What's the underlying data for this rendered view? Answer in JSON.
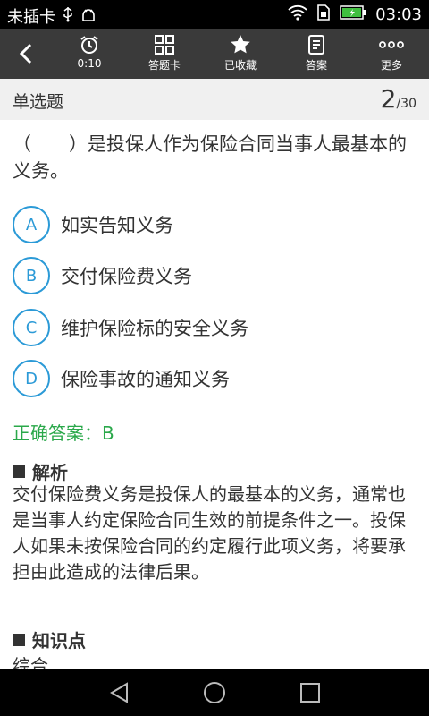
{
  "statusbar": {
    "carrier": "未插卡",
    "time": "03:03",
    "icons": [
      "usb-icon",
      "android-debug-icon",
      "wifi-icon",
      "sim-icon",
      "battery-icon"
    ]
  },
  "toolbar": {
    "items": [
      {
        "icon": "alarm-clock-icon",
        "label": "0:10"
      },
      {
        "icon": "grid-icon",
        "label": "答题卡"
      },
      {
        "icon": "star-icon",
        "label": "已收藏"
      },
      {
        "icon": "document-icon",
        "label": "答案"
      },
      {
        "icon": "more-dots-icon",
        "label": "更多"
      }
    ]
  },
  "question": {
    "type": "单选题",
    "current": "2",
    "total": "/30",
    "text": "（　　）是投保人作为保险合同当事人最基本的义务。",
    "options": [
      {
        "letter": "A",
        "text": "如实告知义务"
      },
      {
        "letter": "B",
        "text": "交付保险费义务"
      },
      {
        "letter": "C",
        "text": "维护保险标的安全义务"
      },
      {
        "letter": "D",
        "text": "保险事故的通知义务"
      }
    ],
    "answer": "正确答案：B"
  },
  "analysis": {
    "title": "解析",
    "text": "交付保险费义务是投保人的最基本的义务，通常也是当事人约定保险合同生效的前提条件之一。投保人如果未按保险合同的约定履行此项义务，将要承担由此造成的法律后果。"
  },
  "knowledge": {
    "title": "知识点",
    "text": "综合"
  },
  "colors": {
    "accent": "#2b9ad7",
    "correct": "#2aa84a",
    "toolbar_bg": "#3a3a3a"
  }
}
